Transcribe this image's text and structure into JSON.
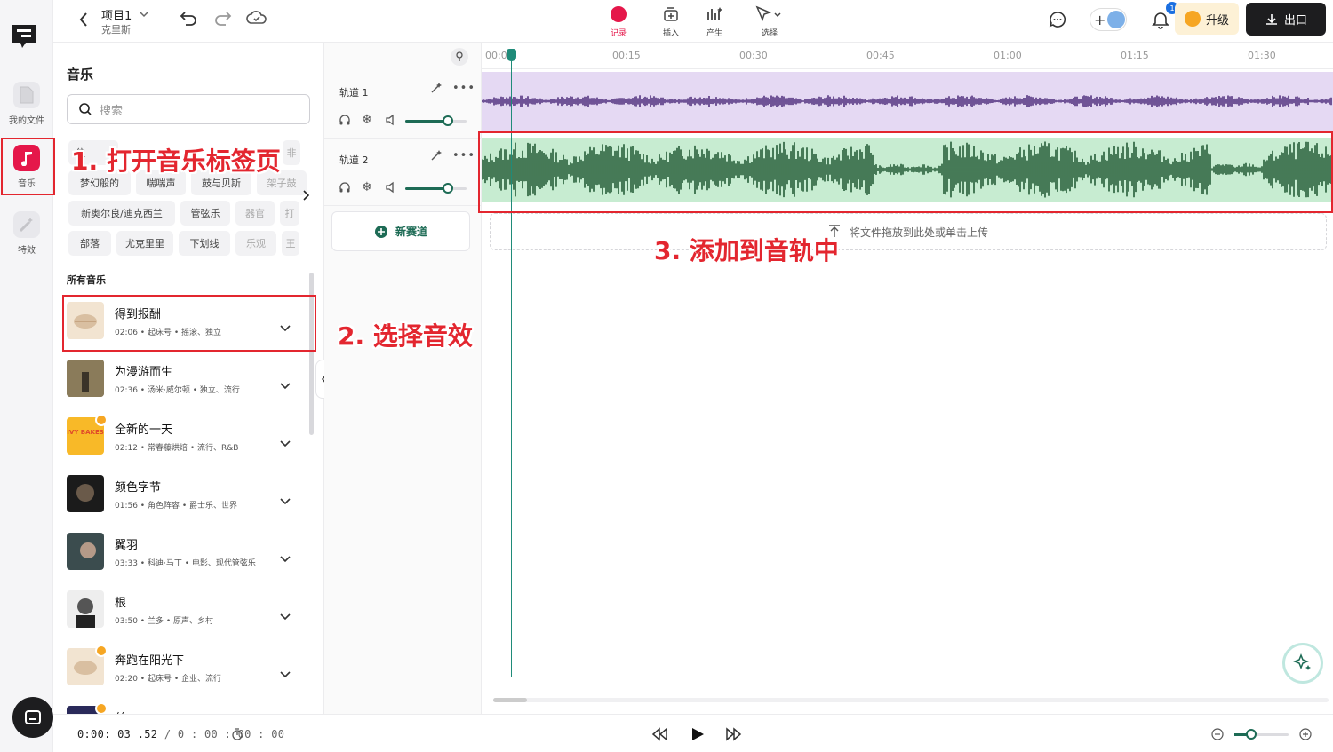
{
  "rail": {
    "items": [
      {
        "label": "我的文件",
        "icon": "file-icon"
      },
      {
        "label": "音乐",
        "icon": "music-note-icon",
        "active": true
      },
      {
        "label": "特效",
        "icon": "magic-wand-icon"
      }
    ]
  },
  "topbar": {
    "project_name": "项目1",
    "project_subtitle": "克里斯",
    "tools": [
      {
        "label": "记录",
        "icon": "record-icon"
      },
      {
        "label": "插入",
        "icon": "insert-icon"
      },
      {
        "label": "产生",
        "icon": "generate-icon"
      },
      {
        "label": "选择",
        "icon": "cursor-icon"
      }
    ],
    "notification_count": "1",
    "upgrade_label": "升级",
    "export_label": "出口"
  },
  "panel": {
    "title": "音乐",
    "search_placeholder": "搜索",
    "chips_row1": [
      "位",
      "非"
    ],
    "chips_row2": [
      "梦幻般的",
      "喘喘声",
      "鼓与贝斯",
      "架子鼓"
    ],
    "chips_row3": [
      "新奥尔良/迪克西兰",
      "管弦乐",
      "器官",
      "打"
    ],
    "chips_row4": [
      "部落",
      "尤克里里",
      "下划线",
      "乐观",
      "王"
    ],
    "section_label": "所有音乐",
    "tracks": [
      {
        "name": "得到报酬",
        "meta": "02:06 • 起床号 • 摇滚、独立"
      },
      {
        "name": "为漫游而生",
        "meta": "02:36 • 汤米·威尔顿 • 独立、流行"
      },
      {
        "name": "全新的一天",
        "meta": "02:12 • 常春藤烘焙 • 流行、R&B"
      },
      {
        "name": "颜色字节",
        "meta": "01:56 • 角色阵容 • 爵士乐、世界"
      },
      {
        "name": "翼羽",
        "meta": "03:33 • 科迪·马丁 • 电影、现代管弦乐"
      },
      {
        "name": "根",
        "meta": "03:50 • 兰多 • 原声、乡村"
      },
      {
        "name": "奔跑在阳光下",
        "meta": "02:20 • 起床号 • 企业、流行"
      },
      {
        "name": "丝",
        "meta": ""
      }
    ],
    "thumb_text_ivy": "IVY BAKES"
  },
  "timeline": {
    "ruler_labels": [
      "00:0",
      "00:15",
      "00:30",
      "00:45",
      "01:00",
      "01:15",
      "01:30"
    ],
    "tracks": [
      {
        "name": "轨道 1",
        "volume_pct": 70
      },
      {
        "name": "轨道 2",
        "volume_pct": 70
      }
    ],
    "new_track_label": "新赛道",
    "drop_zone_text": "将文件拖放到此处或单击上传",
    "wave_colors": {
      "track1_bg": "#e5d9f3",
      "track1_wave": "#3d1a6e",
      "track2_bg": "#c7ecd1",
      "track2_wave": "#0f4a23"
    }
  },
  "bottombar": {
    "current_time": "0:00: 03 .52",
    "separator": "/",
    "total_time": "0 : 00 : 00 : 00"
  },
  "annotations": {
    "step1": "1. 打开音乐标签页",
    "step2": "2. 选择音效",
    "step3": "3. 添加到音轨中"
  },
  "colors": {
    "accent": "#1d6b55",
    "annotation_red": "#e3262f",
    "record_red": "#e5174a"
  }
}
